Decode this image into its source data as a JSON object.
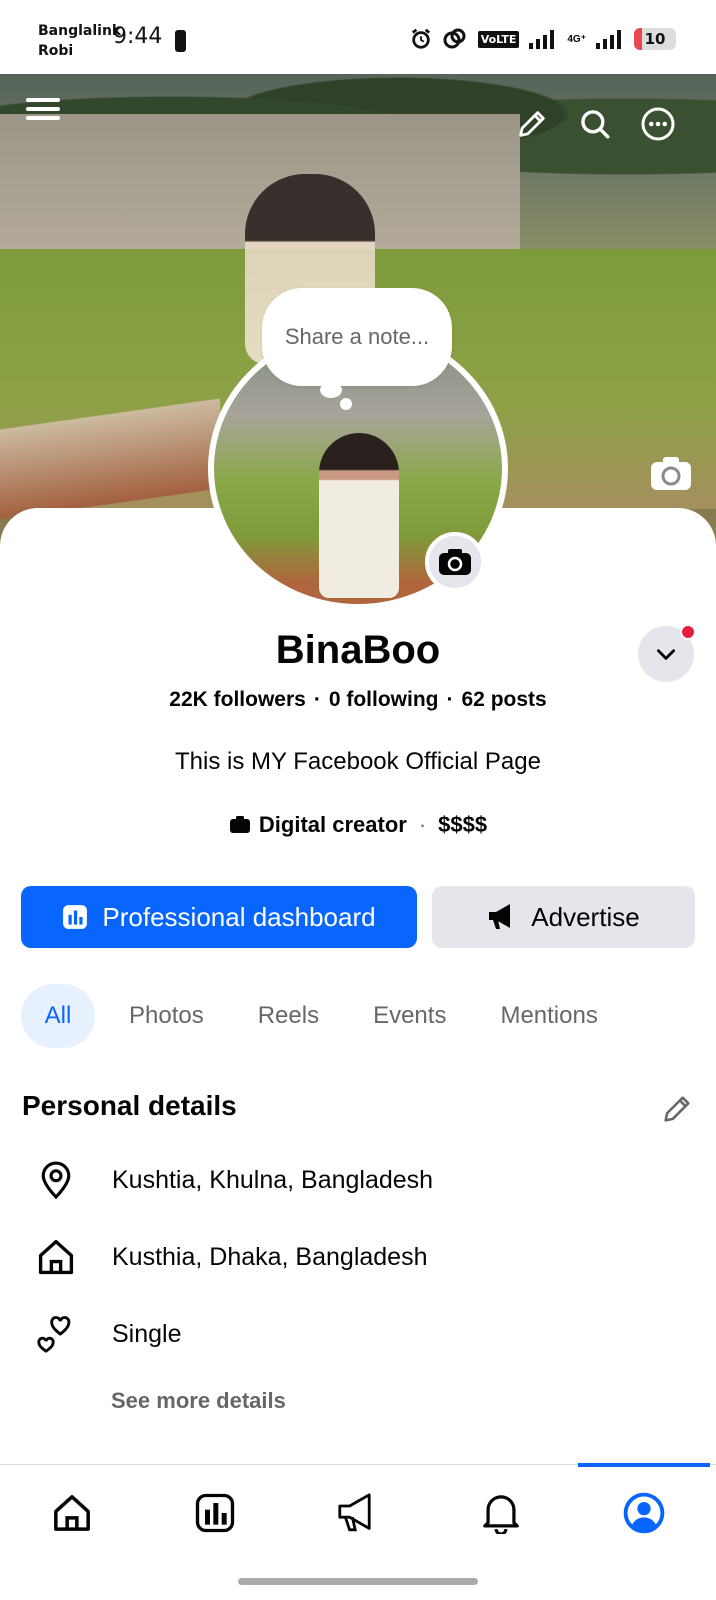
{
  "status_bar": {
    "carrier_1": "Banglalink",
    "carrier_2": "Robi",
    "time": "9:44",
    "volte": "VoLTE",
    "network": "4G⁺",
    "battery": "10"
  },
  "cover": {
    "menu_icon": "hamburger-menu-icon",
    "edit_icon": "pencil-icon",
    "search_icon": "search-icon",
    "more_icon": "more-icon",
    "camera_icon": "camera-icon"
  },
  "note": {
    "placeholder": "Share a note..."
  },
  "profile": {
    "name": "BinaBoo",
    "followers": "22K followers",
    "following": "0 following",
    "posts": "62 posts",
    "separator": "·",
    "bio": "This is MY Facebook Official Page",
    "category": "Digital creator",
    "price": "$$$$"
  },
  "actions": {
    "dashboard_label": "Professional dashboard",
    "advertise_label": "Advertise"
  },
  "tabs": [
    {
      "label": "All",
      "active": true
    },
    {
      "label": "Photos",
      "active": false
    },
    {
      "label": "Reels",
      "active": false
    },
    {
      "label": "Events",
      "active": false
    },
    {
      "label": "Mentions",
      "active": false
    }
  ],
  "personal_details": {
    "title": "Personal details",
    "items": [
      {
        "icon": "location-pin-icon",
        "text": "Kushtia, Khulna, Bangladesh"
      },
      {
        "icon": "home-icon",
        "text": "Kusthia, Dhaka, Bangladesh"
      },
      {
        "icon": "hearts-icon",
        "text": "Single"
      }
    ],
    "see_more": "See more details"
  },
  "bottom_nav": [
    {
      "icon": "home-icon",
      "active": false
    },
    {
      "icon": "dashboard-icon",
      "active": false
    },
    {
      "icon": "megaphone-icon",
      "active": false
    },
    {
      "icon": "bell-icon",
      "active": false
    },
    {
      "icon": "profile-icon",
      "active": true
    }
  ],
  "colors": {
    "primary": "#0866ff",
    "secondary_button": "#e4e6eb",
    "muted_text": "#65676b",
    "notification": "#e41e3f"
  }
}
